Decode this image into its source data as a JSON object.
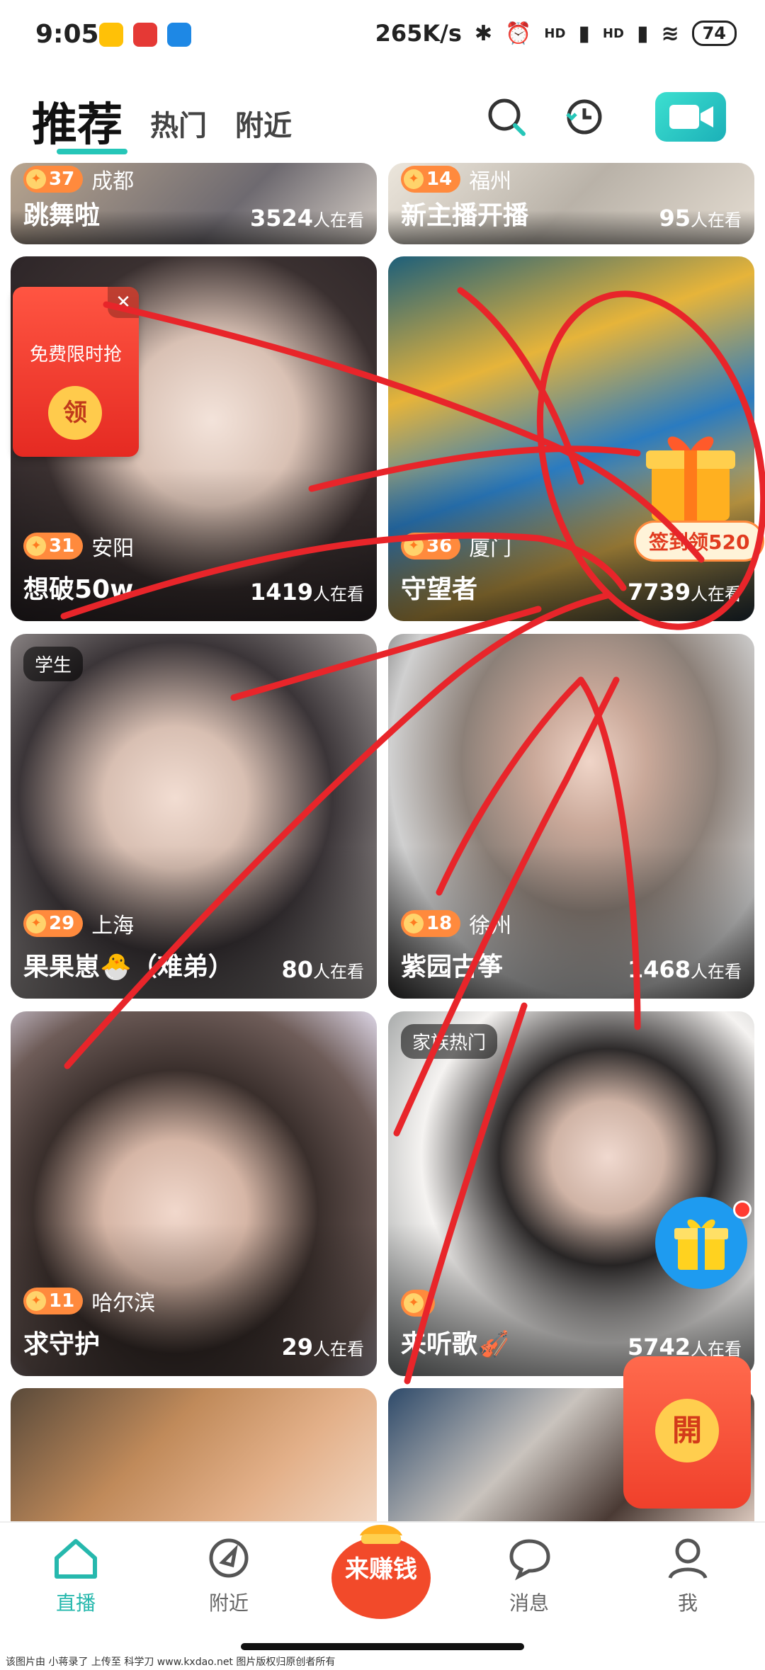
{
  "status_bar": {
    "time": "9:05",
    "net_speed": "265K/s",
    "signal1_label": "HD",
    "signal2_label": "HD",
    "battery": "74"
  },
  "top_nav": {
    "tabs": [
      "推荐",
      "热门",
      "附近"
    ],
    "active_tab": "推荐"
  },
  "streams": [
    {
      "title": "跳舞啦",
      "level": "37",
      "city": "成都",
      "viewers": "3524",
      "viewers_suffix": "人在看"
    },
    {
      "title": "新主播开播",
      "level": "14",
      "city": "福州",
      "viewers": "95",
      "viewers_suffix": "人在看"
    },
    {
      "title": "想破50w",
      "level": "31",
      "city": "安阳",
      "viewers": "1419",
      "viewers_suffix": "人在看"
    },
    {
      "title": "守望者",
      "level": "36",
      "city": "厦门",
      "viewers": "7739",
      "viewers_suffix": "人在看"
    },
    {
      "title": "果果崽🐣（难弟）",
      "level": "29",
      "city": "上海",
      "viewers": "80",
      "viewers_suffix": "人在看",
      "tag": "学生"
    },
    {
      "title": "紫园古筝",
      "level": "18",
      "city": "徐州",
      "viewers": "1468",
      "viewers_suffix": "人在看"
    },
    {
      "title": "求守护",
      "level": "11",
      "city": "哈尔滨",
      "viewers": "29",
      "viewers_suffix": "人在看"
    },
    {
      "title": "来听歌🎻",
      "level": "",
      "city": "",
      "viewers": "5742",
      "viewers_suffix": "人在看",
      "tag": "家族热门"
    }
  ],
  "promo": {
    "free_grab": "免费限时抢",
    "claim": "领",
    "signin_badge": "签到领520",
    "open_pack": "開"
  },
  "bottom_nav": {
    "items": [
      "直播",
      "附近",
      "来赚钱",
      "消息",
      "我"
    ],
    "active": "直播"
  },
  "watermark": "该图片由 小蒋录了 上传至 科学刀 www.kxdao.net 图片版权归原创者所有",
  "colors": {
    "accent": "#26c6b8",
    "level_badge": "#ff8a3d",
    "scribble": "#e8252a"
  }
}
